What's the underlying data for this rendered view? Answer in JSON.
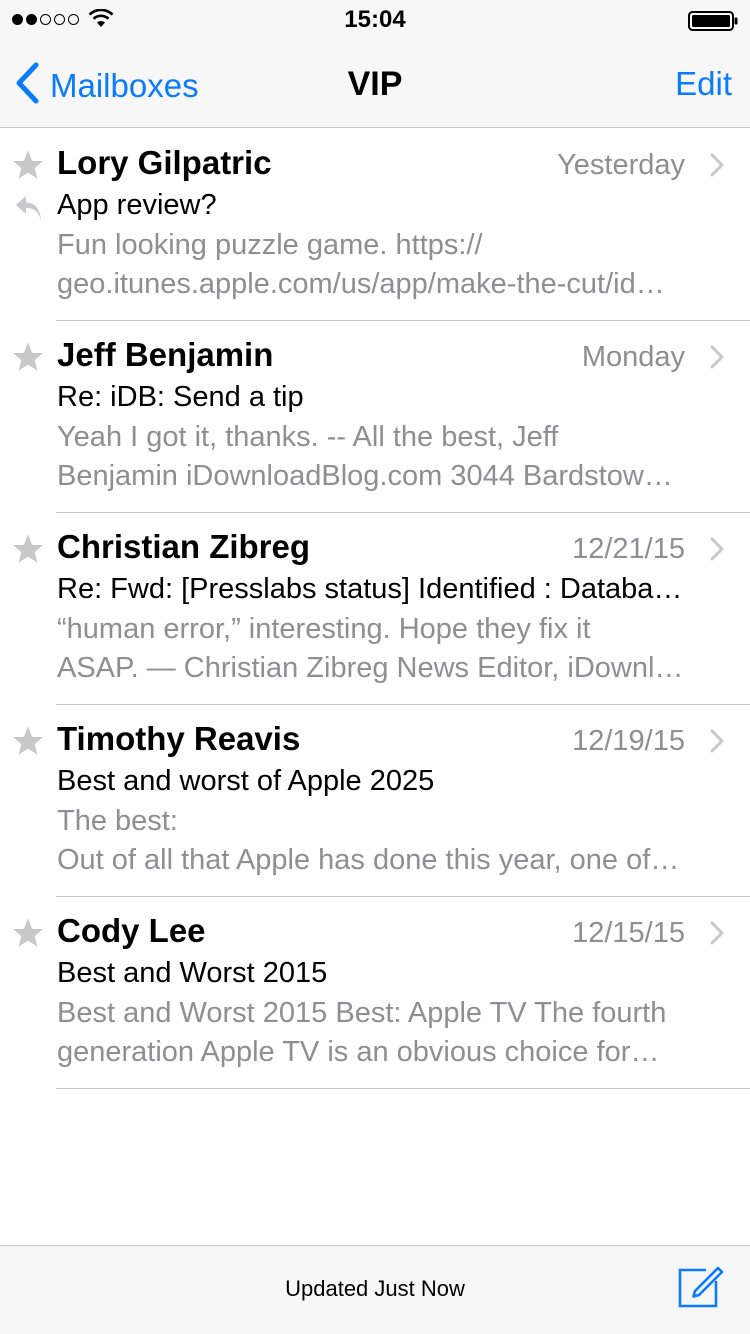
{
  "status_bar": {
    "time": "15:04",
    "signal_bars_filled": 2,
    "signal_bars_total": 5,
    "icons": [
      "wifi-icon",
      "battery-icon"
    ]
  },
  "nav": {
    "back_label": "Mailboxes",
    "title": "VIP",
    "edit_label": "Edit",
    "accent_color": "#0a7aff"
  },
  "messages": [
    {
      "sender": "Lory Gilpatric",
      "date": "Yesterday",
      "subject": "App review?",
      "preview_line1": "Fun looking puzzle game. https://",
      "preview_line2": "geo.itunes.apple.com/us/app/make-the-cut/id…",
      "replied": true
    },
    {
      "sender": "Jeff Benjamin",
      "date": "Monday",
      "subject": "Re: iDB: Send a tip",
      "preview_line1": "Yeah I got it, thanks. -- All the best, Jeff",
      "preview_line2": "Benjamin iDownloadBlog.com 3044 Bardstow…",
      "replied": false
    },
    {
      "sender": "Christian Zibreg",
      "date": "12/21/15",
      "subject": "Re: Fwd: [Presslabs status] Identified : Databa…",
      "preview_line1": "“human error,” interesting. Hope they fix it",
      "preview_line2": "ASAP. — Christian Zibreg News Editor, iDownl…",
      "replied": false
    },
    {
      "sender": "Timothy Reavis",
      "date": "12/19/15",
      "subject": "Best and worst of Apple 2025",
      "preview_line1": "The best:",
      "preview_line2": "Out of all that Apple has done this year, one of…",
      "replied": false
    },
    {
      "sender": "Cody Lee",
      "date": "12/15/15",
      "subject": "Best and Worst 2015",
      "preview_line1": "Best and Worst 2015 Best: Apple TV The fourth",
      "preview_line2": "generation Apple TV is an obvious choice for…",
      "replied": false
    }
  ],
  "toolbar": {
    "status_text": "Updated Just Now",
    "compose_icon": "compose-icon"
  }
}
